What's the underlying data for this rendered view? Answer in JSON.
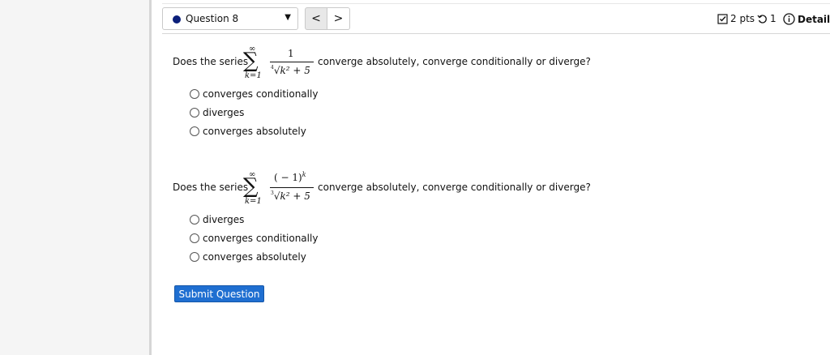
{
  "header": {
    "question_select": "Question 8",
    "prev_label": "<",
    "next_label": ">",
    "points": "2 pts",
    "tries": "1",
    "details": "Details"
  },
  "questions": [
    {
      "prefix": "Does the series",
      "suffix": "converge absolutely, converge conditionally or diverge?",
      "sum_upper": "∞",
      "sum_lower": "k=1",
      "numerator": "1",
      "radical_index": "4",
      "radicand": "k² + 5",
      "options": [
        "converges conditionally",
        "diverges",
        "converges absolutely"
      ]
    },
    {
      "prefix": "Does the series",
      "suffix": "converge absolutely, converge conditionally or diverge?",
      "sum_upper": "∞",
      "sum_lower": "k=1",
      "numerator": "( − 1)",
      "numerator_exp": "k",
      "radical_index": "3",
      "radicand": "k² + 5",
      "options": [
        "diverges",
        "converges conditionally",
        "converges absolutely"
      ]
    }
  ],
  "submit_label": "Submit Question"
}
